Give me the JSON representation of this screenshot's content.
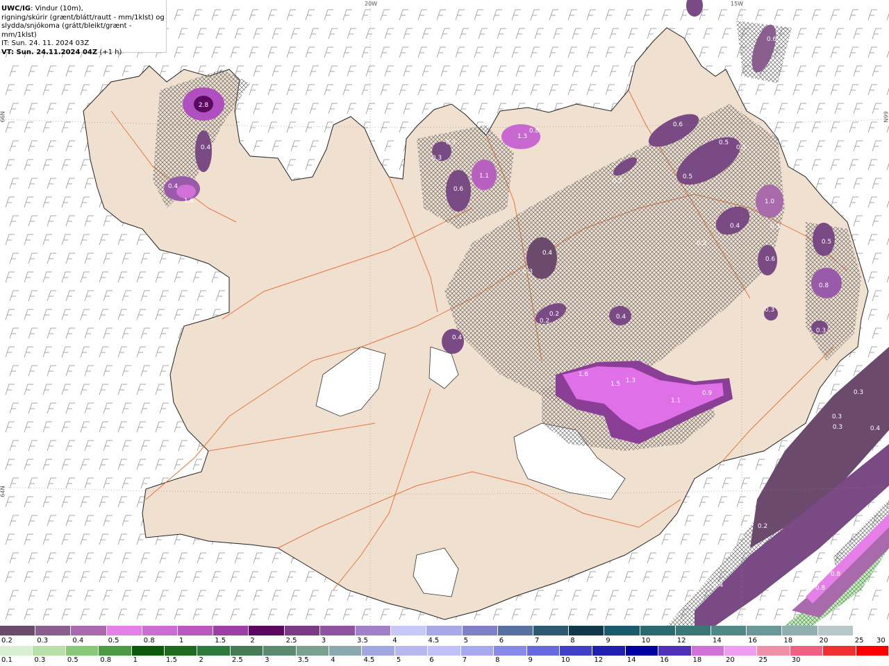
{
  "header": {
    "model": "UWC/IG",
    "line1_rest": ": Vindur (10m),",
    "line2": "rigning/skúrir (grænt/blátt/rautt - mm/1klst) og",
    "line3": "slydda/snjókoma (grátt/bleikt/grænt - mm/1klst)",
    "init_time": "IT: Sun. 24. 11. 2024 03Z",
    "valid_label": "VT: Sun. 24.11.2024 04Z",
    "valid_offset": "(+1 h)"
  },
  "grid_labels": {
    "lon_20w": "20W",
    "lon_15w": "15W",
    "lat_66n_left": "66N",
    "lat_66n_right": "66N",
    "lat_64n_left": "64N"
  },
  "colors": {
    "land": "#f0e0d0",
    "ocean": "#ffffff",
    "roads": "#e8743c",
    "coast": "#202020",
    "barbs": "#8a8a8a",
    "hatch": "#6a6a6a"
  },
  "snow_precip_labels": [
    {
      "v": "2.8"
    },
    {
      "v": "0.4"
    },
    {
      "v": "0.4"
    },
    {
      "v": "1.6"
    },
    {
      "v": "0.3"
    },
    {
      "v": "0.3"
    },
    {
      "v": "0.6"
    },
    {
      "v": "1.1"
    },
    {
      "v": "1.3"
    },
    {
      "v": "0.8"
    },
    {
      "v": "0.6"
    },
    {
      "v": "0.5"
    },
    {
      "v": "0.5"
    },
    {
      "v": "0.5"
    },
    {
      "v": "0.3"
    },
    {
      "v": "1.0"
    },
    {
      "v": "0.4"
    },
    {
      "v": "0.3"
    },
    {
      "v": "0.3"
    },
    {
      "v": "0.6"
    },
    {
      "v": "0.5"
    },
    {
      "v": "0.8"
    },
    {
      "v": "0.4"
    },
    {
      "v": "0.3"
    },
    {
      "v": "0.2"
    },
    {
      "v": "0.2"
    },
    {
      "v": "0.4"
    },
    {
      "v": "0.3"
    },
    {
      "v": "0.3"
    },
    {
      "v": "0.4"
    },
    {
      "v": "1.6"
    },
    {
      "v": "1.5"
    },
    {
      "v": "1.3"
    },
    {
      "v": "1.1"
    },
    {
      "v": "0.9"
    },
    {
      "v": "0.3"
    },
    {
      "v": "0.3"
    },
    {
      "v": "0.3"
    },
    {
      "v": "0.4"
    },
    {
      "v": "0.2"
    },
    {
      "v": "0.4"
    },
    {
      "v": "0.3"
    },
    {
      "v": "0.8"
    },
    {
      "v": "0.8"
    },
    {
      "v": "0.6"
    }
  ],
  "legend_snow": {
    "colors": [
      "#6b4a6e",
      "#8a5e8e",
      "#a86aaa",
      "#e77fe8",
      "#cc6dd3",
      "#bb58c0",
      "#9c3ea5",
      "#5a0860",
      "#7a3a85",
      "#8f52a0",
      "#a080c8",
      "#c8c8f8",
      "#a8a8e8",
      "#8080c8",
      "#5870a0",
      "#2c5870",
      "#10384a",
      "#1a5a6a",
      "#2a6a70",
      "#3a7878",
      "#508888",
      "#6a9898",
      "#90b0b0",
      "#b8c8c8",
      "#ffffff"
    ],
    "labels": [
      "0.2",
      "0.3",
      "0.4",
      "0.5",
      "0.8",
      "1",
      "1.5",
      "2",
      "2.5",
      "3",
      "3.5",
      "4",
      "4.5",
      "5",
      "6",
      "7",
      "8",
      "9",
      "10",
      "12",
      "14",
      "16",
      "18",
      "20",
      "25",
      "30"
    ]
  },
  "legend_rain": {
    "colors": [
      "#d8f0d0",
      "#b8e0a8",
      "#88c878",
      "#4c9a44",
      "#0c5a0c",
      "#206a20",
      "#2c7a3c",
      "#447a54",
      "#5a8a70",
      "#7aa090",
      "#8aa8b0",
      "#a0a8e0",
      "#b8b8f0",
      "#c0c0f8",
      "#a8a8f0",
      "#8888e8",
      "#6868e0",
      "#4040c8",
      "#2020b0",
      "#0000a0",
      "#5030b8",
      "#d070d8",
      "#f09cf0",
      "#f090a8",
      "#f06080",
      "#f03030",
      "#ff0000"
    ],
    "labels": [
      "0.1",
      "0.3",
      "0.5",
      "0.8",
      "1",
      "1.5",
      "2",
      "2.5",
      "3",
      "3.5",
      "4",
      "4.5",
      "5",
      "6",
      "7",
      "8",
      "9",
      "10",
      "12",
      "14",
      "16",
      "18",
      "20",
      "25",
      "30"
    ]
  }
}
